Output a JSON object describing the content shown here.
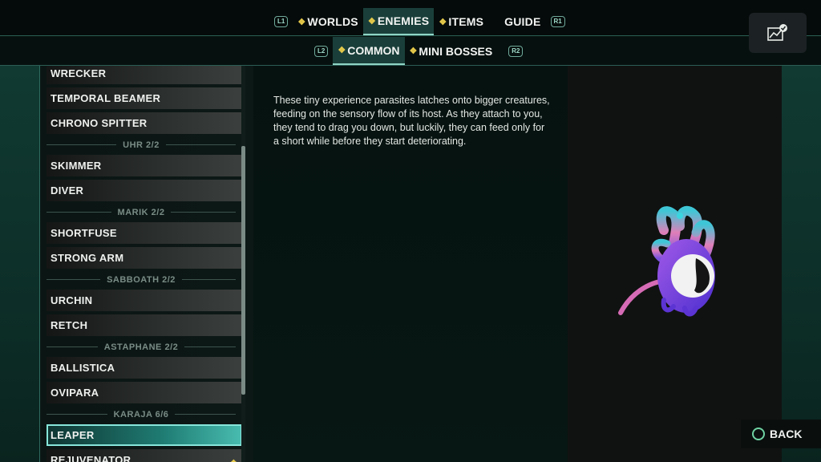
{
  "top_nav": {
    "left_button": "L1",
    "right_button": "R1",
    "tabs": [
      {
        "label": "WORLDS",
        "active": false,
        "diamond": true
      },
      {
        "label": "ENEMIES",
        "active": true,
        "diamond": true
      },
      {
        "label": "ITEMS",
        "active": false,
        "diamond": true
      },
      {
        "label": "GUIDE",
        "active": false,
        "diamond": false
      }
    ]
  },
  "sub_nav": {
    "left_button": "L2",
    "right_button": "R2",
    "tabs": [
      {
        "label": "COMMON",
        "active": true
      },
      {
        "label": "MINI BOSSES",
        "active": false
      }
    ]
  },
  "stats_button": {
    "icon": "stats-check-icon"
  },
  "enemy_list": {
    "entries": [
      {
        "type": "item",
        "label": "WRECKER"
      },
      {
        "type": "item",
        "label": "TEMPORAL BEAMER"
      },
      {
        "type": "item",
        "label": "CHRONO SPITTER"
      },
      {
        "type": "divider",
        "label": "UHR 2/2"
      },
      {
        "type": "item",
        "label": "SKIMMER"
      },
      {
        "type": "item",
        "label": "DIVER"
      },
      {
        "type": "divider",
        "label": "MARIK 2/2"
      },
      {
        "type": "item",
        "label": "SHORTFUSE"
      },
      {
        "type": "item",
        "label": "STRONG ARM"
      },
      {
        "type": "divider",
        "label": "SABBOATH 2/2"
      },
      {
        "type": "item",
        "label": "URCHIN"
      },
      {
        "type": "item",
        "label": "RETCH"
      },
      {
        "type": "divider",
        "label": "ASTAPHANE 2/2"
      },
      {
        "type": "item",
        "label": "BALLISTICA"
      },
      {
        "type": "item",
        "label": "OVIPARA"
      },
      {
        "type": "divider",
        "label": "KARAJA 6/6"
      },
      {
        "type": "item",
        "label": "LEAPER",
        "selected": true
      },
      {
        "type": "item",
        "label": "REJUVENATOR",
        "new": true
      }
    ]
  },
  "detail": {
    "description": "These tiny experience parasites latches onto bigger creatures, feeding on the sensory flow of its host. As they attach to you, they tend to drag you down, but luckily, they can feed only for a short while before they start deteriorating."
  },
  "back_button": {
    "label": "BACK",
    "icon": "circle-button-icon"
  },
  "colors": {
    "accent": "#87e6db",
    "diamond": "#e5c94a",
    "creature_purple": "#8a4fe0",
    "creature_pink": "#e270c0"
  }
}
